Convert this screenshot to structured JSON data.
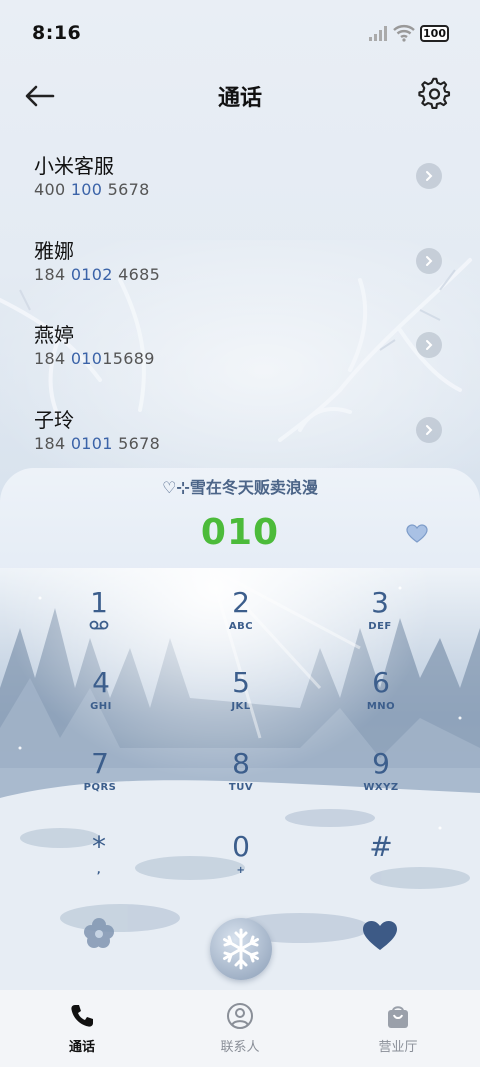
{
  "status_bar": {
    "time": "8:16",
    "battery": "100"
  },
  "header": {
    "title": "通话",
    "back_icon": "arrow-left-icon",
    "settings_icon": "gear-icon"
  },
  "contacts": [
    {
      "name": "小米客服",
      "number_pre": "400 ",
      "number_hl": "100",
      "number_post": " 5678"
    },
    {
      "name": "雅娜",
      "number_pre": "184 ",
      "number_hl": "0102",
      "number_post": " 4685"
    },
    {
      "name": "燕婷",
      "number_pre": "184 ",
      "number_hl": "010",
      "number_post": "15689"
    },
    {
      "name": "子玲",
      "number_pre": "184 ",
      "number_hl": "0101",
      "number_post": " 5678"
    }
  ],
  "dialer": {
    "slogan": "♡⊹雪在冬天贩卖浪漫",
    "input_number": "010",
    "number_color": "#4cbb3a",
    "keys": [
      {
        "digit": "1",
        "letters": "voicemail-icon"
      },
      {
        "digit": "2",
        "letters": "ABC"
      },
      {
        "digit": "3",
        "letters": "DEF"
      },
      {
        "digit": "4",
        "letters": "GHI"
      },
      {
        "digit": "5",
        "letters": "JKL"
      },
      {
        "digit": "6",
        "letters": "MNO"
      },
      {
        "digit": "7",
        "letters": "PQRS"
      },
      {
        "digit": "8",
        "letters": "TUV"
      },
      {
        "digit": "9",
        "letters": "WXYZ"
      },
      {
        "digit": "*",
        "letters": ","
      },
      {
        "digit": "0",
        "letters": "+"
      },
      {
        "digit": "#",
        "letters": ""
      }
    ],
    "left_action_icon": "flower-icon",
    "call_icon": "snowflake-icon",
    "right_action_icon": "heart-icon"
  },
  "bottom_nav": [
    {
      "label": "通话",
      "icon": "phone-icon",
      "active": true
    },
    {
      "label": "联系人",
      "icon": "person-icon",
      "active": false
    },
    {
      "label": "营业厅",
      "icon": "bag-icon",
      "active": false
    }
  ],
  "colors": {
    "accent": "#3c5e8c",
    "active_nav": "#111111",
    "inactive_nav": "#8a8f98"
  }
}
